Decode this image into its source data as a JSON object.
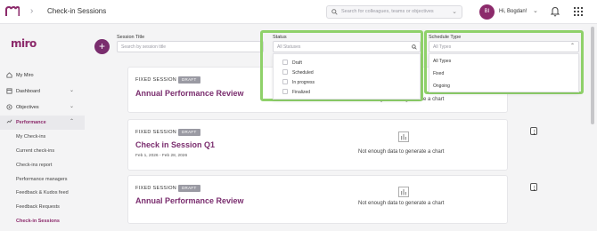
{
  "header": {
    "page_title": "Check-in Sessions",
    "search_placeholder": "Search for colleagues, teams or objectives",
    "avatar_initials": "BI",
    "greeting": "Hi, Bogdan!"
  },
  "sidebar": {
    "brand": "miro",
    "items": [
      {
        "label": "My Miro",
        "icon": "home-icon"
      },
      {
        "label": "Dashboard",
        "icon": "dashboard-icon"
      },
      {
        "label": "Objectives",
        "icon": "target-icon"
      },
      {
        "label": "Performance",
        "icon": "trend-icon"
      }
    ],
    "sub_items": [
      "My Check-ins",
      "Current check-ins",
      "Check-ins report",
      "Performance managers",
      "Feedback & Kudos feed",
      "Feedback Requests",
      "Check-in Sessions"
    ],
    "selected_sub": "Check-in Sessions"
  },
  "filters": {
    "session_title_label": "Session Title",
    "session_title_placeholder": "Search by session title",
    "status_label": "Status",
    "status_placeholder": "All Statuses",
    "status_options": [
      "Draft",
      "Scheduled",
      "In progress",
      "Finalized"
    ],
    "schedule_label": "Schedule Type",
    "schedule_value": "All Types",
    "schedule_options": [
      "All Types",
      "Fixed",
      "Ongoing"
    ]
  },
  "sessions": [
    {
      "type": "FIXED SESSION",
      "badge": "DRAFT",
      "title": "Annual Performance Review",
      "dates": "",
      "chart_text": "Not enough data to generate a chart"
    },
    {
      "type": "FIXED SESSION",
      "badge": "DRAFT",
      "title": "Check in Session Q1",
      "dates": "Feb 1, 2026 - Feb 28, 2026",
      "chart_text": "Not enough data to generate a chart"
    },
    {
      "type": "FIXED SESSION",
      "badge": "DRAFT",
      "title": "Annual Performance Review",
      "dates": "",
      "chart_text": "Not enough data to generate a chart"
    }
  ],
  "colors": {
    "brand": "#8c2a6b",
    "highlight": "#8fd16a",
    "badge": "#9a9aa3"
  }
}
